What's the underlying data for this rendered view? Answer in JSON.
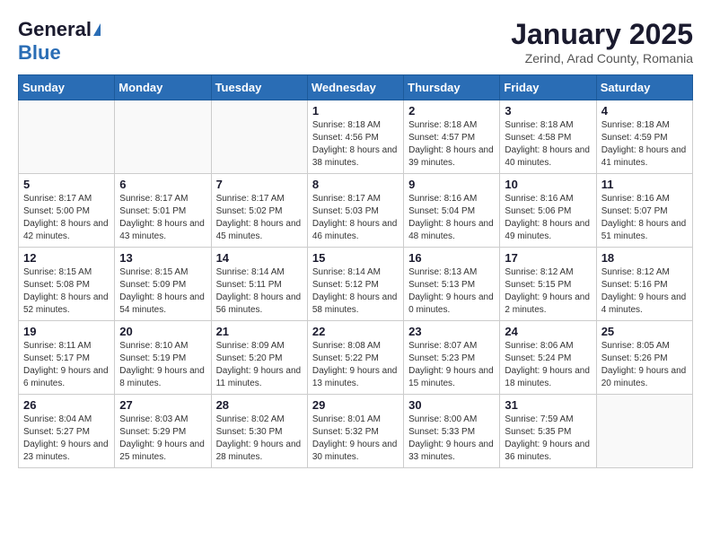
{
  "header": {
    "logo_general": "General",
    "logo_blue": "Blue",
    "month_title": "January 2025",
    "subtitle": "Zerind, Arad County, Romania"
  },
  "weekdays": [
    "Sunday",
    "Monday",
    "Tuesday",
    "Wednesday",
    "Thursday",
    "Friday",
    "Saturday"
  ],
  "weeks": [
    [
      {
        "day": "",
        "info": ""
      },
      {
        "day": "",
        "info": ""
      },
      {
        "day": "",
        "info": ""
      },
      {
        "day": "1",
        "info": "Sunrise: 8:18 AM\nSunset: 4:56 PM\nDaylight: 8 hours\nand 38 minutes."
      },
      {
        "day": "2",
        "info": "Sunrise: 8:18 AM\nSunset: 4:57 PM\nDaylight: 8 hours\nand 39 minutes."
      },
      {
        "day": "3",
        "info": "Sunrise: 8:18 AM\nSunset: 4:58 PM\nDaylight: 8 hours\nand 40 minutes."
      },
      {
        "day": "4",
        "info": "Sunrise: 8:18 AM\nSunset: 4:59 PM\nDaylight: 8 hours\nand 41 minutes."
      }
    ],
    [
      {
        "day": "5",
        "info": "Sunrise: 8:17 AM\nSunset: 5:00 PM\nDaylight: 8 hours\nand 42 minutes."
      },
      {
        "day": "6",
        "info": "Sunrise: 8:17 AM\nSunset: 5:01 PM\nDaylight: 8 hours\nand 43 minutes."
      },
      {
        "day": "7",
        "info": "Sunrise: 8:17 AM\nSunset: 5:02 PM\nDaylight: 8 hours\nand 45 minutes."
      },
      {
        "day": "8",
        "info": "Sunrise: 8:17 AM\nSunset: 5:03 PM\nDaylight: 8 hours\nand 46 minutes."
      },
      {
        "day": "9",
        "info": "Sunrise: 8:16 AM\nSunset: 5:04 PM\nDaylight: 8 hours\nand 48 minutes."
      },
      {
        "day": "10",
        "info": "Sunrise: 8:16 AM\nSunset: 5:06 PM\nDaylight: 8 hours\nand 49 minutes."
      },
      {
        "day": "11",
        "info": "Sunrise: 8:16 AM\nSunset: 5:07 PM\nDaylight: 8 hours\nand 51 minutes."
      }
    ],
    [
      {
        "day": "12",
        "info": "Sunrise: 8:15 AM\nSunset: 5:08 PM\nDaylight: 8 hours\nand 52 minutes."
      },
      {
        "day": "13",
        "info": "Sunrise: 8:15 AM\nSunset: 5:09 PM\nDaylight: 8 hours\nand 54 minutes."
      },
      {
        "day": "14",
        "info": "Sunrise: 8:14 AM\nSunset: 5:11 PM\nDaylight: 8 hours\nand 56 minutes."
      },
      {
        "day": "15",
        "info": "Sunrise: 8:14 AM\nSunset: 5:12 PM\nDaylight: 8 hours\nand 58 minutes."
      },
      {
        "day": "16",
        "info": "Sunrise: 8:13 AM\nSunset: 5:13 PM\nDaylight: 9 hours\nand 0 minutes."
      },
      {
        "day": "17",
        "info": "Sunrise: 8:12 AM\nSunset: 5:15 PM\nDaylight: 9 hours\nand 2 minutes."
      },
      {
        "day": "18",
        "info": "Sunrise: 8:12 AM\nSunset: 5:16 PM\nDaylight: 9 hours\nand 4 minutes."
      }
    ],
    [
      {
        "day": "19",
        "info": "Sunrise: 8:11 AM\nSunset: 5:17 PM\nDaylight: 9 hours\nand 6 minutes."
      },
      {
        "day": "20",
        "info": "Sunrise: 8:10 AM\nSunset: 5:19 PM\nDaylight: 9 hours\nand 8 minutes."
      },
      {
        "day": "21",
        "info": "Sunrise: 8:09 AM\nSunset: 5:20 PM\nDaylight: 9 hours\nand 11 minutes."
      },
      {
        "day": "22",
        "info": "Sunrise: 8:08 AM\nSunset: 5:22 PM\nDaylight: 9 hours\nand 13 minutes."
      },
      {
        "day": "23",
        "info": "Sunrise: 8:07 AM\nSunset: 5:23 PM\nDaylight: 9 hours\nand 15 minutes."
      },
      {
        "day": "24",
        "info": "Sunrise: 8:06 AM\nSunset: 5:24 PM\nDaylight: 9 hours\nand 18 minutes."
      },
      {
        "day": "25",
        "info": "Sunrise: 8:05 AM\nSunset: 5:26 PM\nDaylight: 9 hours\nand 20 minutes."
      }
    ],
    [
      {
        "day": "26",
        "info": "Sunrise: 8:04 AM\nSunset: 5:27 PM\nDaylight: 9 hours\nand 23 minutes."
      },
      {
        "day": "27",
        "info": "Sunrise: 8:03 AM\nSunset: 5:29 PM\nDaylight: 9 hours\nand 25 minutes."
      },
      {
        "day": "28",
        "info": "Sunrise: 8:02 AM\nSunset: 5:30 PM\nDaylight: 9 hours\nand 28 minutes."
      },
      {
        "day": "29",
        "info": "Sunrise: 8:01 AM\nSunset: 5:32 PM\nDaylight: 9 hours\nand 30 minutes."
      },
      {
        "day": "30",
        "info": "Sunrise: 8:00 AM\nSunset: 5:33 PM\nDaylight: 9 hours\nand 33 minutes."
      },
      {
        "day": "31",
        "info": "Sunrise: 7:59 AM\nSunset: 5:35 PM\nDaylight: 9 hours\nand 36 minutes."
      },
      {
        "day": "",
        "info": ""
      }
    ]
  ]
}
